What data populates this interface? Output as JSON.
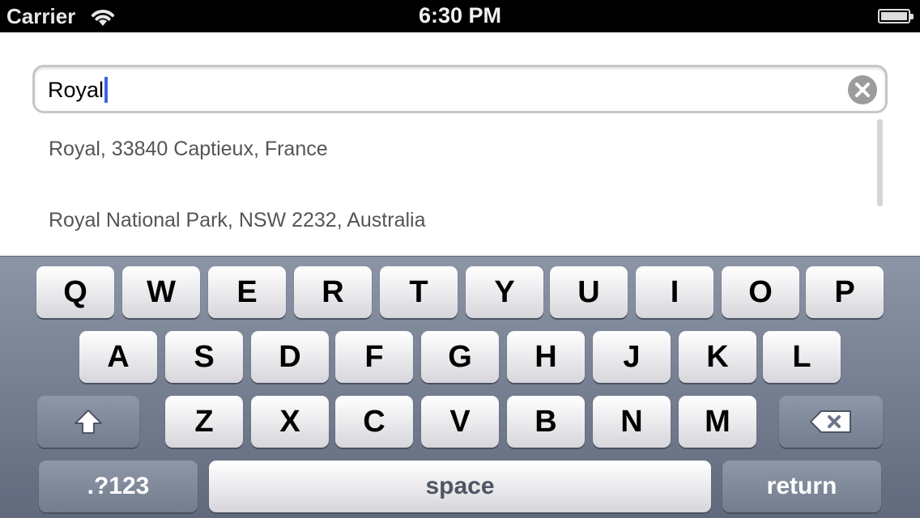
{
  "status_bar": {
    "carrier": "Carrier",
    "time": "6:30 PM"
  },
  "search": {
    "value": "Royal"
  },
  "results": [
    "Royal, 33840 Captieux, France",
    "Royal National Park, NSW 2232, Australia"
  ],
  "keyboard": {
    "row1": [
      "Q",
      "W",
      "E",
      "R",
      "T",
      "Y",
      "U",
      "I",
      "O",
      "P"
    ],
    "row2": [
      "A",
      "S",
      "D",
      "F",
      "G",
      "H",
      "J",
      "K",
      "L"
    ],
    "row3": [
      "Z",
      "X",
      "C",
      "V",
      "B",
      "N",
      "M"
    ],
    "numbers_label": ".?123",
    "space_label": "space",
    "return_label": "return"
  },
  "icons": {
    "wifi": "wifi-icon",
    "battery": "battery-icon",
    "clear": "clear-icon",
    "shift": "shift-icon",
    "delete": "delete-icon"
  },
  "colors": {
    "caret": "#3b66e0",
    "keyboard_bg": "#6f798b"
  }
}
